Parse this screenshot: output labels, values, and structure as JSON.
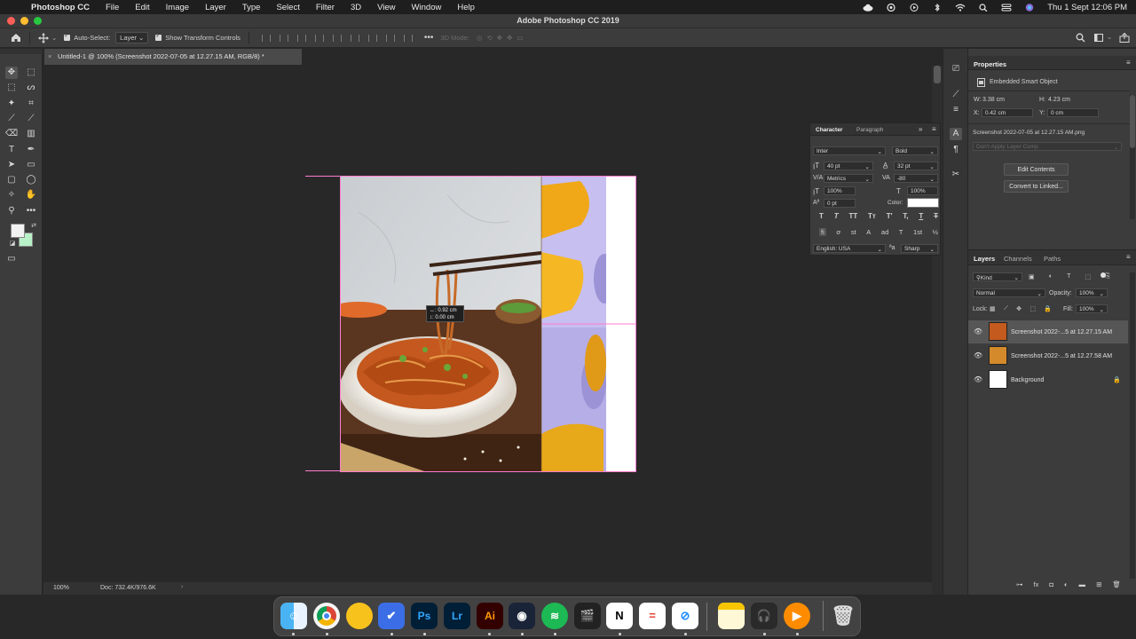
{
  "menubar": {
    "apple": "",
    "app": "Photoshop CC",
    "items": [
      "File",
      "Edit",
      "Image",
      "Layer",
      "Type",
      "Select",
      "Filter",
      "3D",
      "View",
      "Window",
      "Help"
    ],
    "datetime": "Thu 1 Sept  12:06 PM"
  },
  "window": {
    "title": "Adobe Photoshop CC 2019"
  },
  "optionsbar": {
    "auto_select_label": "Auto-Select:",
    "auto_select_value": "Layer",
    "show_transform_label": "Show Transform Controls",
    "mode_3d_label": "3D Mode:"
  },
  "document": {
    "tab_title": "Untitled-1 @ 100% (Screenshot 2022-07-05 at 12.27.15 AM, RGB/8) *",
    "close_glyph": "×",
    "measure_w": "↔: 0.92 cm",
    "measure_h": "↕: 0.00 cm"
  },
  "statusbar": {
    "zoom": "100%",
    "doc_size": "Doc: 732.4K/976.6K",
    "arrow": "›"
  },
  "properties": {
    "tab": "Properties",
    "type": "Embedded Smart Object",
    "w_label": "W:",
    "w": "3.38 cm",
    "h_label": "H:",
    "h": "4.23 cm",
    "x_label": "X:",
    "x": "0.42 cm",
    "y_label": "Y:",
    "y": "0 cm",
    "filename": "Screenshot 2022-07-05 at 12.27.15 AM.png",
    "layer_comp": "Don't Apply Layer Comp",
    "edit_contents": "Edit Contents",
    "convert_linked": "Convert to Linked..."
  },
  "character": {
    "tab_character": "Character",
    "tab_paragraph": "Paragraph",
    "font_family": "Inter",
    "font_style": "Bold",
    "font_size": "40 pt",
    "leading": "32 pt",
    "kerning": "Metrics",
    "tracking": "-80",
    "vscale": "100%",
    "hscale": "100%",
    "baseline": "0 pt",
    "color_label": "Color:",
    "language": "English: USA",
    "antialias": "Sharp",
    "style_buttons": [
      "T",
      "T",
      "TT",
      "Tт",
      "T'",
      "T,",
      "T",
      "T"
    ],
    "opentype_buttons": [
      "fi",
      "ơ",
      "st",
      "A",
      "ad",
      "T",
      "1st",
      "½"
    ]
  },
  "layers": {
    "tabs": [
      "Layers",
      "Channels",
      "Paths"
    ],
    "kind": "Kind",
    "blend_mode": "Normal",
    "opacity_label": "Opacity:",
    "opacity": "100%",
    "lock_label": "Lock:",
    "fill_label": "Fill:",
    "fill": "100%",
    "items": [
      {
        "name": "Screenshot 2022-...5 at 12.27.15 AM"
      },
      {
        "name": "Screenshot 2022-...5 at 12.27.58 AM"
      },
      {
        "name": "Background"
      }
    ],
    "footer_icons": [
      "link-icon",
      "fx-icon",
      "mask-icon",
      "adjustment-icon",
      "group-icon",
      "new-layer-icon",
      "trash-icon"
    ]
  },
  "dock": {
    "apps": [
      "Finder",
      "Chrome",
      "Notes-alt",
      "Tasks",
      "Ps",
      "Lr",
      "Ai",
      "DaVinci",
      "Spotify",
      "Final Cut",
      "N",
      "Toggl",
      "Safari",
      "Notes",
      "Audio",
      "VLC",
      "Trash"
    ]
  },
  "colors": {
    "accent_pink": "#ff7bd0",
    "ps_blue": "#31a8ff",
    "ai_orange": "#ff9a00",
    "lr_blue": "#31a8ff"
  }
}
